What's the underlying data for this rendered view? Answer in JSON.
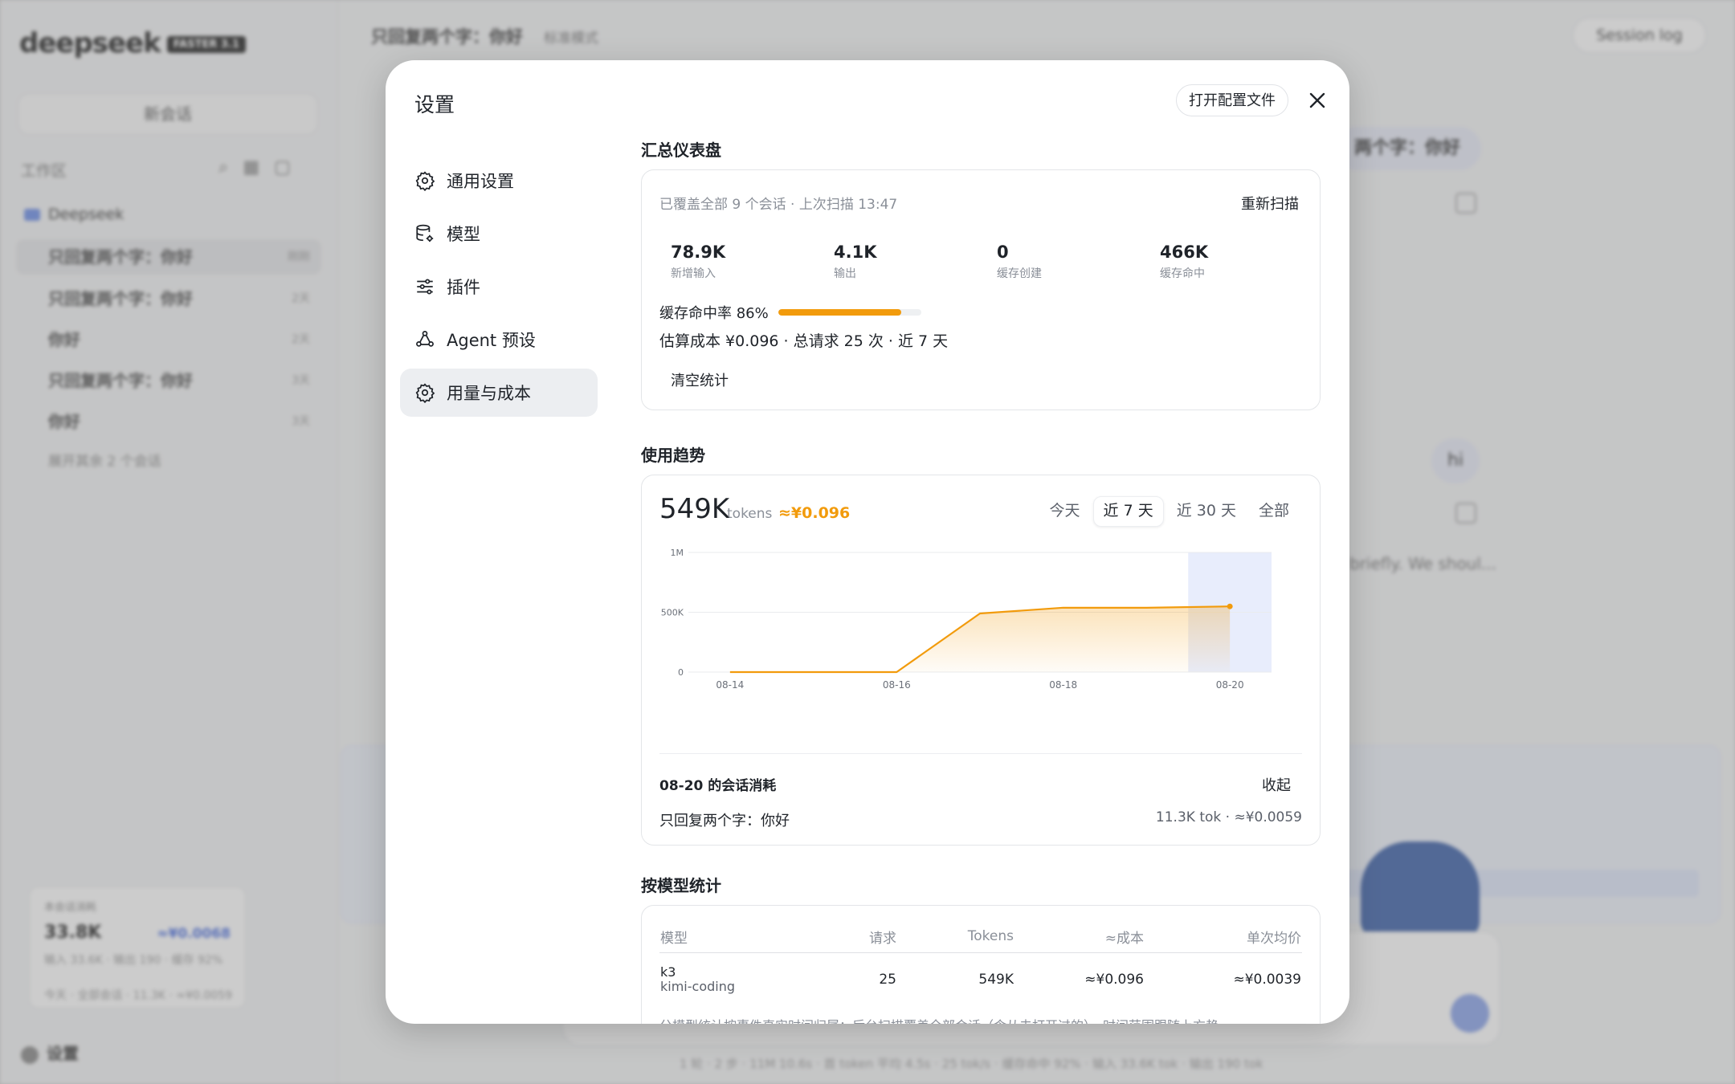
{
  "modal": {
    "title": "设置",
    "open_config_label": "打开配置文件"
  },
  "nav": {
    "items": [
      {
        "label": "通用设置",
        "icon": "gear-icon"
      },
      {
        "label": "模型",
        "icon": "database-gear-icon"
      },
      {
        "label": "插件",
        "icon": "sliders-icon"
      },
      {
        "label": "Agent 预设",
        "icon": "agent-icon"
      },
      {
        "label": "用量与成本",
        "icon": "gear-icon",
        "active": true
      }
    ]
  },
  "dashboard": {
    "title": "汇总仪表盘",
    "meta": "已覆盖全部 9 个会话 · 上次扫描 13:47",
    "rescan_label": "重新扫描",
    "stats": [
      {
        "value": "78.9K",
        "label": "新增输入"
      },
      {
        "value": "4.1K",
        "label": "输出"
      },
      {
        "value": "0",
        "label": "缓存创建"
      },
      {
        "value": "466K",
        "label": "缓存命中"
      }
    ],
    "cache_hit_label": "缓存命中率 86%",
    "cache_hit_ratio": 0.86,
    "cost_summary": "估算成本 ¥0.096 · 总请求 25 次 · 近 7 天",
    "clear_label": "清空统计"
  },
  "trend": {
    "title": "使用趋势",
    "total": "549K",
    "unit": "tokens",
    "cost": "≈¥0.096",
    "ranges": [
      {
        "label": "今天"
      },
      {
        "label": "近 7 天",
        "active": true
      },
      {
        "label": "近 30 天"
      },
      {
        "label": "全部"
      }
    ],
    "day_title": "08-20 的会话消耗",
    "collapse_label": "收起",
    "session_name": "只回复两个字：你好",
    "session_value": "11.3K tok · ≈¥0.0059"
  },
  "chart_data": {
    "type": "area",
    "x": [
      "08-14",
      "08-15",
      "08-16",
      "08-17",
      "08-18",
      "08-19",
      "08-20"
    ],
    "x_tick_labels": [
      "08-14",
      "08-16",
      "08-18",
      "08-20"
    ],
    "values": [
      0,
      0,
      0,
      490000,
      538000,
      538000,
      549000
    ],
    "y_tick_labels": [
      "1M",
      "500K",
      "0"
    ],
    "ylim": [
      0,
      1000000
    ],
    "highlight_x": "08-20",
    "color": "#f29b0c",
    "highlight_color": "#e8edfc",
    "grid": true
  },
  "models": {
    "title": "按模型统计",
    "columns": [
      "模型",
      "请求",
      "Tokens",
      "≈成本",
      "单次均价"
    ],
    "rows": [
      {
        "model": "k3",
        "provider": "kimi-coding",
        "requests": "25",
        "tokens": "549K",
        "cost": "≈¥0.096",
        "avg": "≈¥0.0039"
      }
    ],
    "note": "分模型统计按事件真实时间归属；后台扫描覆盖全部会话（含从未打开过的），时间范围跟随上方趋"
  },
  "background": {
    "logo": "deepseek",
    "logo_tag": "FASTER 3.1",
    "new_chat": "新会话",
    "workspace": "工作区",
    "folder": "Deepseek",
    "items": [
      {
        "label": "只回复两个字：你好",
        "meta": "刚刚"
      },
      {
        "label": "只回复两个字：你好",
        "meta": "2天"
      },
      {
        "label": "你好",
        "meta": "2天"
      },
      {
        "label": "只回复两个字：你好",
        "meta": "3天"
      },
      {
        "label": "你好",
        "meta": "3天"
      }
    ],
    "more": "展开其余 2 个会话",
    "card_label": "本会话消耗",
    "card_value": "33.8K",
    "card_cost": "≈¥0.0068",
    "card_line": "输入 33.6K · 输出 190 · 缓存 92%",
    "card_foot": "今天 · 全部会话 · 11.3K · ≈¥0.0059",
    "settings": "设置",
    "top_title": "只回复两个字：你好",
    "top_sub": "标准模式",
    "session_log": "Session log",
    "bubble1": "两个字：你好",
    "bubble2": "hi",
    "snippet": "briefly. We shoul...",
    "status": "1 轮 · 2 步 · 11M 10.6s · 首 token 平均 4.5s · 25 tok/s · 缓存命中 92% · 输入 33.6K tok · 输出 190 tok"
  }
}
